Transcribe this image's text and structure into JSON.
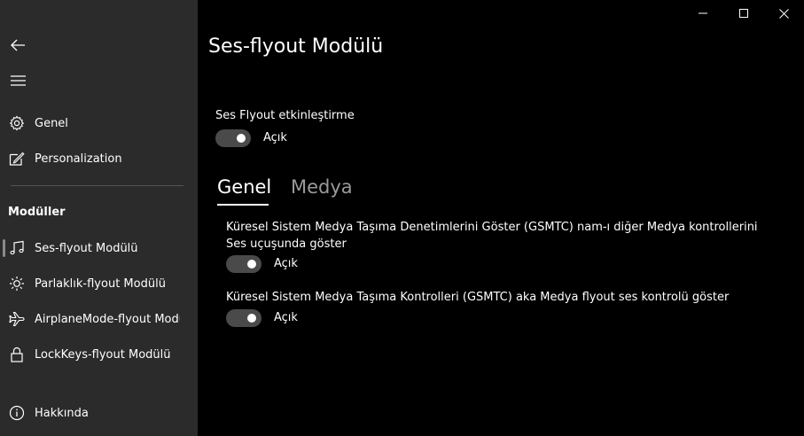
{
  "window": {
    "minimize_icon": "minimize-icon",
    "maximize_icon": "maximize-icon",
    "close_icon": "close-icon"
  },
  "sidebar": {
    "back_icon": "back-arrow-icon",
    "menu_icon": "hamburger-icon",
    "items": [
      {
        "label": "Genel",
        "icon": "gear-icon"
      },
      {
        "label": "Personalization",
        "icon": "pen-window-icon"
      }
    ],
    "section_header": "Modüller",
    "modules": [
      {
        "label": "Ses-flyout Modülü",
        "icon": "music-note-icon",
        "active": true
      },
      {
        "label": "Parlaklık-flyout Modülü",
        "icon": "brightness-icon"
      },
      {
        "label": "AirplaneMode-flyout Modülü",
        "icon": "airplane-icon"
      },
      {
        "label": "LockKeys-flyout Modülü",
        "icon": "lock-icon"
      }
    ],
    "footer": {
      "label": "Hakkında",
      "icon": "info-icon"
    }
  },
  "main": {
    "title": "Ses-flyout Modülü",
    "enable": {
      "label": "Ses Flyout etkinleştirme",
      "state": "Açık",
      "on": true
    },
    "tabs": [
      {
        "label": "Genel",
        "active": true
      },
      {
        "label": "Medya",
        "active": false
      }
    ],
    "settings": [
      {
        "label": "Küresel Sistem Medya Taşıma Denetimlerini Göster (GSMTC) nam-ı diğer Medya kontrollerini Ses uçuşunda göster",
        "state": "Açık",
        "on": true
      },
      {
        "label": "Küresel Sistem Medya Taşıma Kontrolleri (GSMTC) aka Medya flyout ses kontrolü göster",
        "state": "Açık",
        "on": true
      }
    ]
  }
}
